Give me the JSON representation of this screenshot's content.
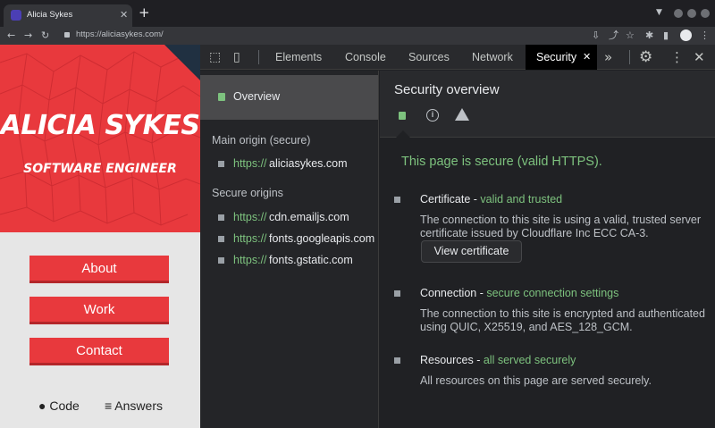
{
  "browser": {
    "tab_title": "Alicia Sykes",
    "tab_close": "✕",
    "new_tab": "+",
    "url_scheme": "https://",
    "url_host": "aliciasykes.com/",
    "nav": {
      "back": "←",
      "forward": "→",
      "reload": "↻"
    }
  },
  "site": {
    "name": "ALICIA SYKES",
    "role": "SOFTWARE ENGINEER",
    "buttons": [
      "About",
      "Work",
      "Contact"
    ],
    "links": {
      "code": "Code",
      "answers": "Answers"
    },
    "colors": {
      "brand": "#e8393d",
      "corner": "#203041"
    }
  },
  "devtools": {
    "tabs": [
      "Elements",
      "Console",
      "Sources",
      "Network",
      "Security"
    ],
    "active_tab": "Security",
    "active_tab_close": "✕",
    "more_tabs": "»",
    "close": "✕",
    "sidebar": {
      "overview": "Overview",
      "main_origin_heading": "Main origin (secure)",
      "main_origin": {
        "scheme": "https://",
        "host": "aliciasykes.com"
      },
      "secure_origins_heading": "Secure origins",
      "secure_origins": [
        {
          "scheme": "https://",
          "host": "cdn.emailjs.com"
        },
        {
          "scheme": "https://",
          "host": "fonts.googleapis.com"
        },
        {
          "scheme": "https://",
          "host": "fonts.gstatic.com"
        }
      ]
    },
    "overview": {
      "title": "Security overview",
      "summary_message": "This page is secure (valid HTTPS).",
      "certificate": {
        "title": "Certificate - ",
        "status": "valid and trusted",
        "description": "The connection to this site is using a valid, trusted server certificate issued by Cloudflare Inc ECC CA-3.",
        "button": "View certificate"
      },
      "connection": {
        "title": "Connection - ",
        "status": "secure connection settings",
        "description": "The connection to this site is encrypted and authenticated using QUIC, X25519, and AES_128_GCM."
      },
      "resources": {
        "title": "Resources - ",
        "status": "all served securely",
        "description": "All resources on this page are served securely."
      }
    },
    "colors": {
      "secure_green": "#7dc27e",
      "panel_bg": "#202124"
    }
  }
}
